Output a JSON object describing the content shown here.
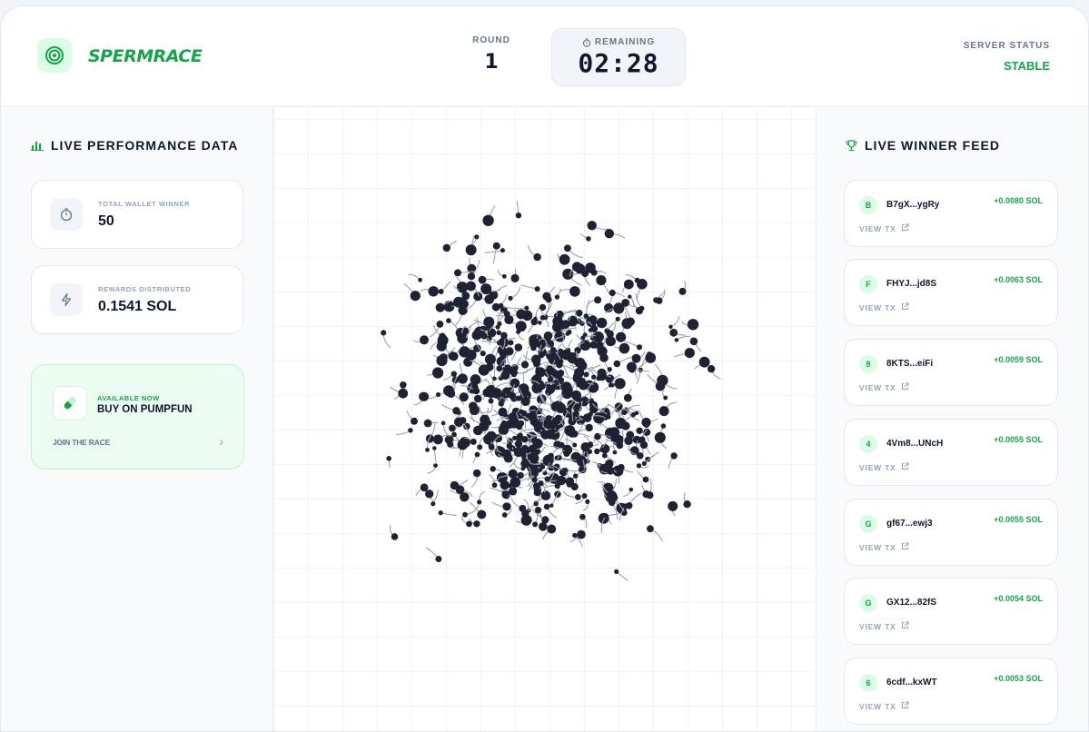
{
  "header": {
    "brand": "SPERMRACE",
    "round_label": "ROUND",
    "round_value": "1",
    "remaining_label": "REMAINING",
    "remaining_value": "02:28",
    "server_label": "SERVER STATUS",
    "server_value": "STABLE",
    "accent": "#16a34a"
  },
  "left": {
    "title": "LIVE PERFORMANCE DATA",
    "stats": [
      {
        "label": "TOTAL WALLET WINNER",
        "value": "50",
        "icon": "stopwatch-icon"
      },
      {
        "label": "REWARDS DISTRIBUTED",
        "value": "0.1541 SOL",
        "icon": "lightning-icon"
      }
    ],
    "promo": {
      "available": "AVAILABLE NOW",
      "buy": "BUY ON PUMPFUN",
      "join": "JOIN THE RACE",
      "icon": "pill-icon"
    }
  },
  "feed": {
    "title": "LIVE WINNER FEED",
    "view_label": "VIEW TX",
    "items": [
      {
        "badge": "B",
        "wallet": "B7gX...ygRy",
        "amount": "+0.0080 SOL"
      },
      {
        "badge": "F",
        "wallet": "FHYJ...jd8S",
        "amount": "+0.0063 SOL"
      },
      {
        "badge": "8",
        "wallet": "8KTS...eiFi",
        "amount": "+0.0059 SOL"
      },
      {
        "badge": "4",
        "wallet": "4Vm8...UNcH",
        "amount": "+0.0055 SOL"
      },
      {
        "badge": "G",
        "wallet": "gf67...ewj3",
        "amount": "+0.0055 SOL"
      },
      {
        "badge": "G",
        "wallet": "GX12...82fS",
        "amount": "+0.0054 SOL"
      },
      {
        "badge": "6",
        "wallet": "6cdf...kxWT",
        "amount": "+0.0053 SOL"
      }
    ]
  }
}
